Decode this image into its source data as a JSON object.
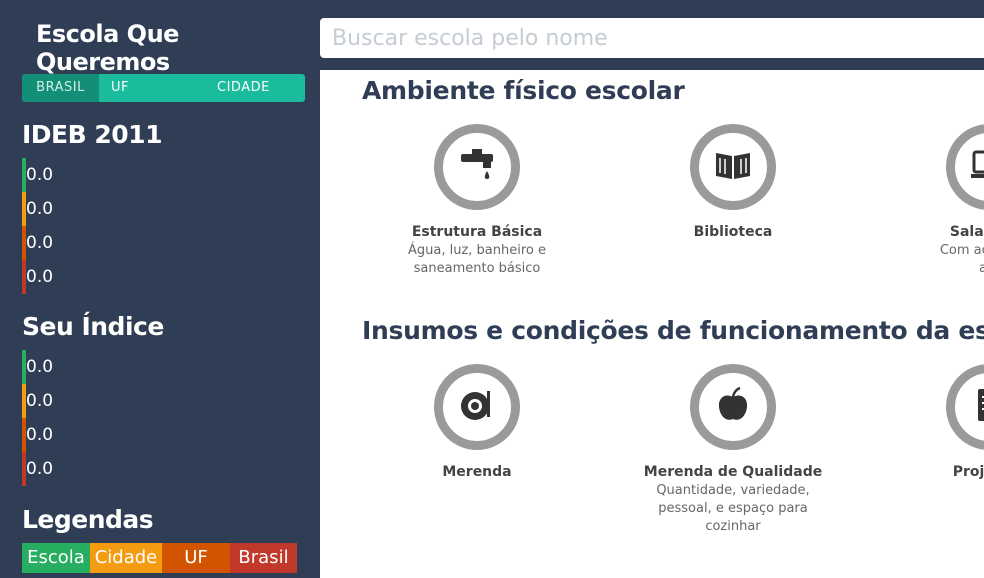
{
  "app": {
    "title": "Escola Que Queremos"
  },
  "scope_tabs": [
    {
      "label": "BRASIL",
      "active": true
    },
    {
      "label": "UF",
      "active": false
    },
    {
      "label": "CIDADE",
      "active": false
    }
  ],
  "ideb": {
    "title": "IDEB 2011",
    "values": [
      "0.0",
      "0.0",
      "0.0",
      "0.0"
    ]
  },
  "seu_indice": {
    "title": "Seu Índice",
    "values": [
      "0.0",
      "0.0",
      "0.0",
      "0.0"
    ]
  },
  "indicator_colors": [
    "#27ae60",
    "#f39c12",
    "#d35400",
    "#c0392b"
  ],
  "legend": {
    "title": "Legendas",
    "items": [
      {
        "label": "Escola",
        "color": "#27ae60"
      },
      {
        "label": "Cidade",
        "color": "#f39c12"
      },
      {
        "label": "UF",
        "color": "#d35400"
      },
      {
        "label": "Brasil",
        "color": "#c0392b"
      }
    ]
  },
  "search": {
    "placeholder": "Buscar escola pelo nome"
  },
  "sections": [
    {
      "heading": "Ambiente físico escolar",
      "cards": [
        {
          "icon": "faucet-icon",
          "title": "Estrutura Básica",
          "desc": [
            "Água, luz, banheiro e",
            "saneamento básico"
          ]
        },
        {
          "icon": "book-icon",
          "title": "Biblioteca",
          "desc": []
        },
        {
          "icon": "computer-icon",
          "title": "Sala de In",
          "desc": [
            "Com acesso à i",
            "alu"
          ]
        }
      ]
    },
    {
      "heading": "Insumos e condições de funcionamento da escola",
      "cards": [
        {
          "icon": "plate-icon",
          "title": "Merenda",
          "desc": []
        },
        {
          "icon": "apple-icon",
          "title": "Merenda de Qualidade",
          "desc": [
            "Quantidade, variedade,",
            "pessoal, e espaço para",
            "cozinhar"
          ]
        },
        {
          "icon": "document-icon",
          "title": "Projeto P",
          "desc": []
        }
      ]
    }
  ]
}
